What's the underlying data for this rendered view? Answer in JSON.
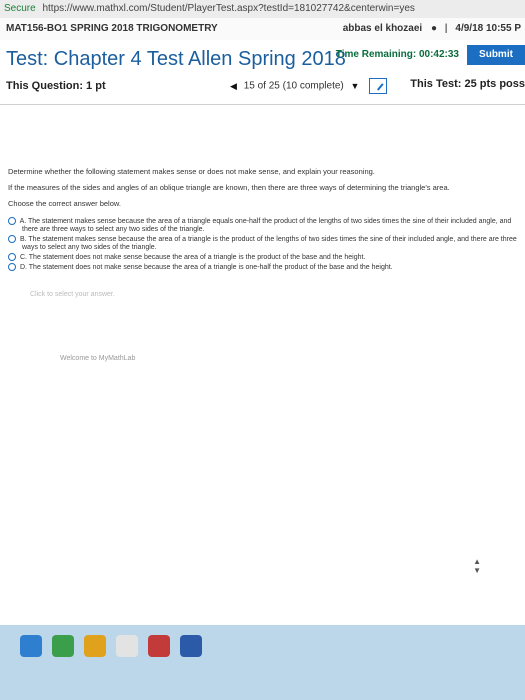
{
  "browser": {
    "secure_label": "Secure",
    "url": "https://www.mathxl.com/Student/PlayerTest.aspx?testId=181027742&centerwin=yes"
  },
  "course": {
    "name": "MAT156-BO1 SPRING 2018 TRIGONOMETRY",
    "user": "abbas el khozaei",
    "date": "4/9/18 10:55 P"
  },
  "test": {
    "title": "Test: Chapter 4 Test Allen Spring 2018",
    "time_label": "Time Remaining:",
    "time_value": "00:42:33",
    "submit_label": "Submit",
    "question_points": "This Question: 1 pt",
    "progress": "15 of 25 (10 complete)",
    "test_points": "This Test: 25 pts poss"
  },
  "question": {
    "prompt": "Determine whether the following statement makes sense or does not make sense, and explain your reasoning.",
    "statement": "If the measures of the sides and angles of an oblique triangle are known, then there are three ways of determining the triangle's area.",
    "instruction": "Choose the correct answer below.",
    "options": [
      {
        "letter": "A.",
        "text": "The statement makes sense because the area of a triangle equals one-half the product of the lengths of two sides times the sine of their included angle, and",
        "cont": "there are three ways to select any two sides of the triangle."
      },
      {
        "letter": "B.",
        "text": "The statement makes sense because the area of a triangle is the product of the lengths of two sides times the sine of their included angle, and there are three",
        "cont": "ways to select any two sides of the triangle."
      },
      {
        "letter": "C.",
        "text": "The statement does not make sense because the area of a triangle is the product of the base and the height.",
        "cont": ""
      },
      {
        "letter": "D.",
        "text": "The statement does not make sense because the area of a triangle is one-half the product of the base and the height.",
        "cont": ""
      }
    ],
    "hint": "Click to select your answer.",
    "footer": "Welcome to MyMathLab"
  },
  "colors": {
    "title_blue": "#1b5e9e",
    "submit_blue": "#1b6ec2",
    "time_green": "#0a6b3d"
  }
}
